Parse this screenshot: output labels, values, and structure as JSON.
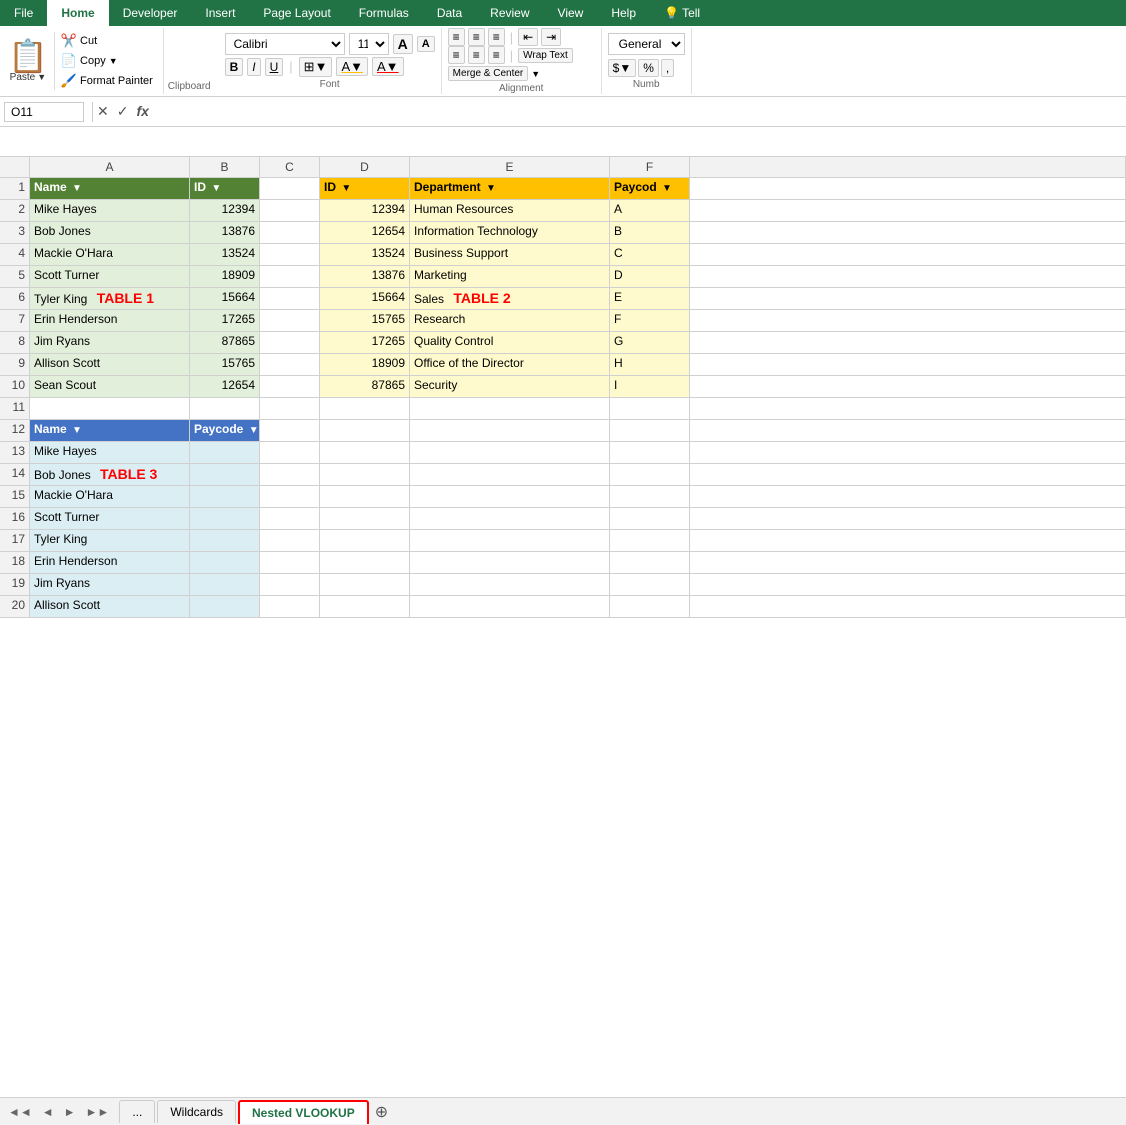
{
  "ribbon": {
    "tabs": [
      "File",
      "Home",
      "Developer",
      "Insert",
      "Page Layout",
      "Formulas",
      "Data",
      "Review",
      "View",
      "Help",
      "Tell"
    ],
    "active_tab": "Home",
    "clipboard": {
      "paste_label": "Paste",
      "cut_label": "Cut",
      "copy_label": "Copy",
      "format_painter_label": "Format Painter",
      "group_label": "Clipboard"
    },
    "font": {
      "font_name": "Calibri",
      "font_size": "11",
      "grow_icon": "A",
      "shrink_icon": "A",
      "bold": "B",
      "italic": "I",
      "underline": "U",
      "group_label": "Font"
    },
    "alignment": {
      "wrap_text": "Wrap Text",
      "merge_center": "Merge & Center",
      "group_label": "Alignment"
    },
    "number": {
      "format": "General",
      "group_label": "Numb"
    }
  },
  "formula_bar": {
    "cell_ref": "O11",
    "icons": [
      "✕",
      "✓",
      "fx"
    ]
  },
  "columns": [
    "A",
    "B",
    "C",
    "D",
    "E",
    "F"
  ],
  "col_widths": {
    "A": 160,
    "B": 70,
    "C": 60,
    "D": 90,
    "E": 200,
    "F": 80
  },
  "rows": [
    {
      "num": 1,
      "cells": [
        {
          "col": "A",
          "val": "Name",
          "header": true,
          "style": "hdr-green",
          "dropdown": true
        },
        {
          "col": "B",
          "val": "ID",
          "header": true,
          "style": "hdr-green",
          "dropdown": true
        },
        {
          "col": "C",
          "val": "",
          "style": ""
        },
        {
          "col": "D",
          "val": "ID",
          "header": true,
          "style": "hdr-orange",
          "dropdown": true
        },
        {
          "col": "E",
          "val": "Department",
          "header": true,
          "style": "hdr-orange",
          "dropdown": true
        },
        {
          "col": "F",
          "val": "Paycod",
          "header": true,
          "style": "hdr-orange",
          "dropdown": true
        }
      ]
    },
    {
      "num": 2,
      "cells": [
        {
          "col": "A",
          "val": "Mike Hayes",
          "style": "bg-light-green"
        },
        {
          "col": "B",
          "val": "12394",
          "style": "bg-light-green num"
        },
        {
          "col": "C",
          "val": "",
          "style": ""
        },
        {
          "col": "D",
          "val": "12394",
          "style": "bg-light-yellow num"
        },
        {
          "col": "E",
          "val": "Human Resources",
          "style": "bg-light-yellow"
        },
        {
          "col": "F",
          "val": "A",
          "style": "bg-light-yellow"
        }
      ]
    },
    {
      "num": 3,
      "cells": [
        {
          "col": "A",
          "val": "Bob Jones",
          "style": "bg-light-green"
        },
        {
          "col": "B",
          "val": "13876",
          "style": "bg-light-green num"
        },
        {
          "col": "C",
          "val": "",
          "style": ""
        },
        {
          "col": "D",
          "val": "12654",
          "style": "bg-light-yellow num"
        },
        {
          "col": "E",
          "val": "Information Technology",
          "style": "bg-light-yellow"
        },
        {
          "col": "F",
          "val": "B",
          "style": "bg-light-yellow"
        }
      ]
    },
    {
      "num": 4,
      "cells": [
        {
          "col": "A",
          "val": "Mackie O'Hara",
          "style": "bg-light-green"
        },
        {
          "col": "B",
          "val": "13524",
          "style": "bg-light-green num"
        },
        {
          "col": "C",
          "val": "",
          "style": ""
        },
        {
          "col": "D",
          "val": "13524",
          "style": "bg-light-yellow num"
        },
        {
          "col": "E",
          "val": "Business Support",
          "style": "bg-light-yellow"
        },
        {
          "col": "F",
          "val": "C",
          "style": "bg-light-yellow"
        }
      ]
    },
    {
      "num": 5,
      "cells": [
        {
          "col": "A",
          "val": "Scott Turner",
          "style": "bg-light-green"
        },
        {
          "col": "B",
          "val": "18909",
          "style": "bg-light-green num"
        },
        {
          "col": "C",
          "val": "",
          "style": ""
        },
        {
          "col": "D",
          "val": "13876",
          "style": "bg-light-yellow num"
        },
        {
          "col": "E",
          "val": "Marketing",
          "style": "bg-light-yellow"
        },
        {
          "col": "F",
          "val": "D",
          "style": "bg-light-yellow"
        }
      ]
    },
    {
      "num": 6,
      "cells": [
        {
          "col": "A",
          "val": "Tyler King",
          "style": "bg-light-green",
          "table_label": "TABLE 1"
        },
        {
          "col": "B",
          "val": "15664",
          "style": "bg-light-green num"
        },
        {
          "col": "C",
          "val": "",
          "style": ""
        },
        {
          "col": "D",
          "val": "15664",
          "style": "bg-light-yellow num"
        },
        {
          "col": "E",
          "val": "Sales",
          "style": "bg-light-yellow",
          "table_label": "TABLE 2"
        },
        {
          "col": "F",
          "val": "E",
          "style": "bg-light-yellow"
        }
      ]
    },
    {
      "num": 7,
      "cells": [
        {
          "col": "A",
          "val": "Erin Henderson",
          "style": "bg-light-green"
        },
        {
          "col": "B",
          "val": "17265",
          "style": "bg-light-green num"
        },
        {
          "col": "C",
          "val": "",
          "style": ""
        },
        {
          "col": "D",
          "val": "15765",
          "style": "bg-light-yellow num"
        },
        {
          "col": "E",
          "val": "Research",
          "style": "bg-light-yellow"
        },
        {
          "col": "F",
          "val": "F",
          "style": "bg-light-yellow"
        }
      ]
    },
    {
      "num": 8,
      "cells": [
        {
          "col": "A",
          "val": "Jim Ryans",
          "style": "bg-light-green"
        },
        {
          "col": "B",
          "val": "87865",
          "style": "bg-light-green num"
        },
        {
          "col": "C",
          "val": "",
          "style": ""
        },
        {
          "col": "D",
          "val": "17265",
          "style": "bg-light-yellow num"
        },
        {
          "col": "E",
          "val": "Quality Control",
          "style": "bg-light-yellow"
        },
        {
          "col": "F",
          "val": "G",
          "style": "bg-light-yellow"
        }
      ]
    },
    {
      "num": 9,
      "cells": [
        {
          "col": "A",
          "val": "Allison Scott",
          "style": "bg-light-green"
        },
        {
          "col": "B",
          "val": "15765",
          "style": "bg-light-green num"
        },
        {
          "col": "C",
          "val": "",
          "style": ""
        },
        {
          "col": "D",
          "val": "18909",
          "style": "bg-light-yellow num"
        },
        {
          "col": "E",
          "val": "Office of the Director",
          "style": "bg-light-yellow"
        },
        {
          "col": "F",
          "val": "H",
          "style": "bg-light-yellow"
        }
      ]
    },
    {
      "num": 10,
      "cells": [
        {
          "col": "A",
          "val": "Sean Scout",
          "style": "bg-light-green"
        },
        {
          "col": "B",
          "val": "12654",
          "style": "bg-light-green num"
        },
        {
          "col": "C",
          "val": "",
          "style": ""
        },
        {
          "col": "D",
          "val": "87865",
          "style": "bg-light-yellow num"
        },
        {
          "col": "E",
          "val": "Security",
          "style": "bg-light-yellow"
        },
        {
          "col": "F",
          "val": "I",
          "style": "bg-light-yellow"
        }
      ]
    },
    {
      "num": 11,
      "cells": [
        {
          "col": "A",
          "val": "",
          "style": ""
        },
        {
          "col": "B",
          "val": "",
          "style": ""
        },
        {
          "col": "C",
          "val": "",
          "style": ""
        },
        {
          "col": "D",
          "val": "",
          "style": ""
        },
        {
          "col": "E",
          "val": "",
          "style": ""
        },
        {
          "col": "F",
          "val": "",
          "style": ""
        }
      ]
    },
    {
      "num": 12,
      "cells": [
        {
          "col": "A",
          "val": "Name",
          "header": true,
          "style": "hdr-blue",
          "dropdown": true
        },
        {
          "col": "B",
          "val": "Paycode",
          "header": true,
          "style": "hdr-blue",
          "dropdown": true
        },
        {
          "col": "C",
          "val": "",
          "style": ""
        },
        {
          "col": "D",
          "val": "",
          "style": ""
        },
        {
          "col": "E",
          "val": "",
          "style": ""
        },
        {
          "col": "F",
          "val": "",
          "style": ""
        }
      ]
    },
    {
      "num": 13,
      "cells": [
        {
          "col": "A",
          "val": "Mike Hayes",
          "style": "bg-light-blue"
        },
        {
          "col": "B",
          "val": "",
          "style": "bg-light-blue"
        },
        {
          "col": "C",
          "val": "",
          "style": ""
        },
        {
          "col": "D",
          "val": "",
          "style": ""
        },
        {
          "col": "E",
          "val": "",
          "style": ""
        },
        {
          "col": "F",
          "val": "",
          "style": ""
        }
      ]
    },
    {
      "num": 14,
      "cells": [
        {
          "col": "A",
          "val": "Bob Jones",
          "style": "bg-light-blue",
          "table_label": "TABLE 3"
        },
        {
          "col": "B",
          "val": "",
          "style": "bg-light-blue"
        },
        {
          "col": "C",
          "val": "",
          "style": ""
        },
        {
          "col": "D",
          "val": "",
          "style": ""
        },
        {
          "col": "E",
          "val": "",
          "style": ""
        },
        {
          "col": "F",
          "val": "",
          "style": ""
        }
      ]
    },
    {
      "num": 15,
      "cells": [
        {
          "col": "A",
          "val": "Mackie O'Hara",
          "style": "bg-light-blue"
        },
        {
          "col": "B",
          "val": "",
          "style": "bg-light-blue"
        },
        {
          "col": "C",
          "val": "",
          "style": ""
        },
        {
          "col": "D",
          "val": "",
          "style": ""
        },
        {
          "col": "E",
          "val": "",
          "style": ""
        },
        {
          "col": "F",
          "val": "",
          "style": ""
        }
      ]
    },
    {
      "num": 16,
      "cells": [
        {
          "col": "A",
          "val": "Scott Turner",
          "style": "bg-light-blue"
        },
        {
          "col": "B",
          "val": "",
          "style": "bg-light-blue"
        },
        {
          "col": "C",
          "val": "",
          "style": ""
        },
        {
          "col": "D",
          "val": "",
          "style": ""
        },
        {
          "col": "E",
          "val": "",
          "style": ""
        },
        {
          "col": "F",
          "val": "",
          "style": ""
        }
      ]
    },
    {
      "num": 17,
      "cells": [
        {
          "col": "A",
          "val": "Tyler King",
          "style": "bg-light-blue"
        },
        {
          "col": "B",
          "val": "",
          "style": "bg-light-blue"
        },
        {
          "col": "C",
          "val": "",
          "style": ""
        },
        {
          "col": "D",
          "val": "",
          "style": ""
        },
        {
          "col": "E",
          "val": "",
          "style": ""
        },
        {
          "col": "F",
          "val": "",
          "style": ""
        }
      ]
    },
    {
      "num": 18,
      "cells": [
        {
          "col": "A",
          "val": "Erin Henderson",
          "style": "bg-light-blue"
        },
        {
          "col": "B",
          "val": "",
          "style": "bg-light-blue"
        },
        {
          "col": "C",
          "val": "",
          "style": ""
        },
        {
          "col": "D",
          "val": "",
          "style": ""
        },
        {
          "col": "E",
          "val": "",
          "style": ""
        },
        {
          "col": "F",
          "val": "",
          "style": ""
        }
      ]
    },
    {
      "num": 19,
      "cells": [
        {
          "col": "A",
          "val": "Jim Ryans",
          "style": "bg-light-blue"
        },
        {
          "col": "B",
          "val": "",
          "style": "bg-light-blue"
        },
        {
          "col": "C",
          "val": "",
          "style": ""
        },
        {
          "col": "D",
          "val": "",
          "style": ""
        },
        {
          "col": "E",
          "val": "",
          "style": ""
        },
        {
          "col": "F",
          "val": "",
          "style": ""
        }
      ]
    },
    {
      "num": 20,
      "cells": [
        {
          "col": "A",
          "val": "Allison Scott",
          "style": "bg-light-blue"
        },
        {
          "col": "B",
          "val": "",
          "style": "bg-light-blue"
        },
        {
          "col": "C",
          "val": "",
          "style": ""
        },
        {
          "col": "D",
          "val": "",
          "style": ""
        },
        {
          "col": "E",
          "val": "",
          "style": ""
        },
        {
          "col": "F",
          "val": "",
          "style": ""
        }
      ]
    }
  ],
  "sheet_tabs": {
    "nav": [
      "◄◄",
      "◄",
      "►",
      "►►"
    ],
    "tabs": [
      "...",
      "Wildcards",
      "Nested VLOOKUP"
    ],
    "active_tab": "Nested VLOOKUP",
    "add": "+"
  }
}
